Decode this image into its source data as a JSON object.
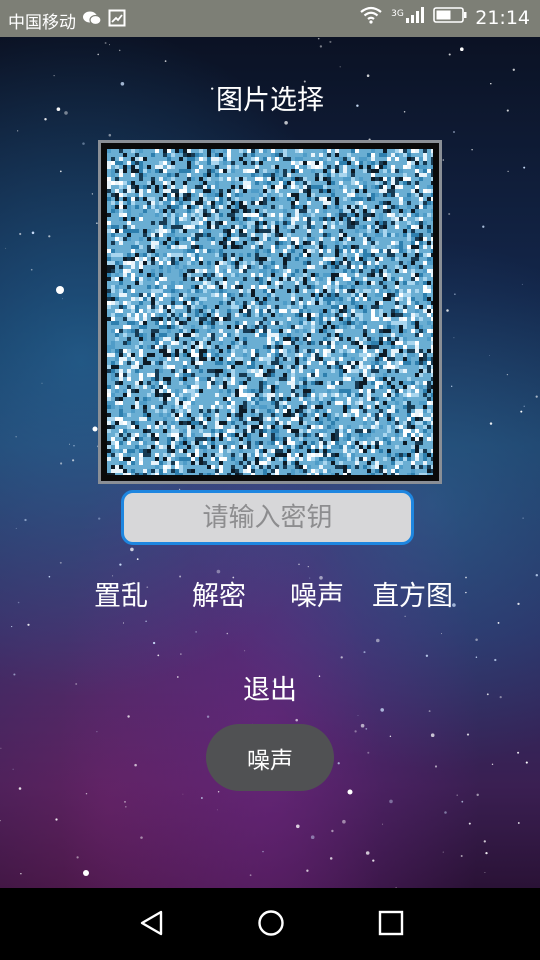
{
  "status_bar": {
    "carrier": "中国移动",
    "network_type": "3G",
    "time": "21:14",
    "icons": [
      "wechat-icon",
      "image-notification-icon",
      "wifi-icon",
      "signal-icon",
      "battery-icon"
    ]
  },
  "page": {
    "title": "图片选择",
    "preview_description": "scrambled noise image"
  },
  "key_input": {
    "placeholder": "请输入密钥",
    "value": ""
  },
  "actions": {
    "scramble": "置乱",
    "decrypt": "解密",
    "noise": "噪声",
    "histogram": "直方图"
  },
  "exit": {
    "label": "退出"
  },
  "toast": {
    "text": "噪声"
  },
  "navigation": {
    "icons": [
      "back-icon",
      "home-icon",
      "recents-icon"
    ]
  },
  "colors": {
    "accent": "#1e86e0",
    "status_bar": "#7d7f76",
    "toast_bg": "#505153"
  }
}
